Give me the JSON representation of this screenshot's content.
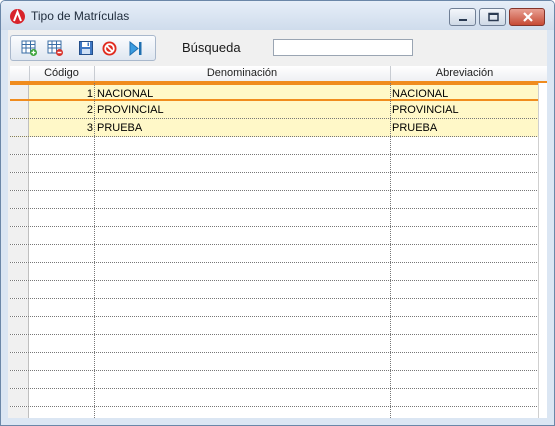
{
  "window": {
    "title": "Tipo de Matrículas",
    "icon": "app-logo-icon",
    "buttons": [
      "minimize-icon",
      "maximize-icon",
      "close-icon"
    ]
  },
  "toolbar": {
    "buttons": [
      {
        "name": "add-record-button",
        "icon": "grid-add-icon"
      },
      {
        "name": "delete-record-button",
        "icon": "grid-delete-icon"
      },
      {
        "name": "save-button",
        "icon": "save-icon"
      },
      {
        "name": "cancel-button",
        "icon": "cancel-icon"
      },
      {
        "name": "exit-button",
        "icon": "exit-icon"
      }
    ],
    "search_label": "Búsqueda",
    "search_value": ""
  },
  "grid": {
    "columns": [
      "Código",
      "Denominación",
      "Abreviación"
    ],
    "rows": [
      {
        "codigo": "1",
        "denominacion": "NACIONAL",
        "abreviacion": "NACIONAL"
      },
      {
        "codigo": "2",
        "denominacion": "PROVINCIAL",
        "abreviacion": "PROVINCIAL"
      },
      {
        "codigo": "3",
        "denominacion": "PRUEBA",
        "abreviacion": "PRUEBA"
      }
    ],
    "selected_row": 1,
    "colors": {
      "selection_border": "#f08c1e",
      "row_fill": "#fff8c8"
    }
  }
}
